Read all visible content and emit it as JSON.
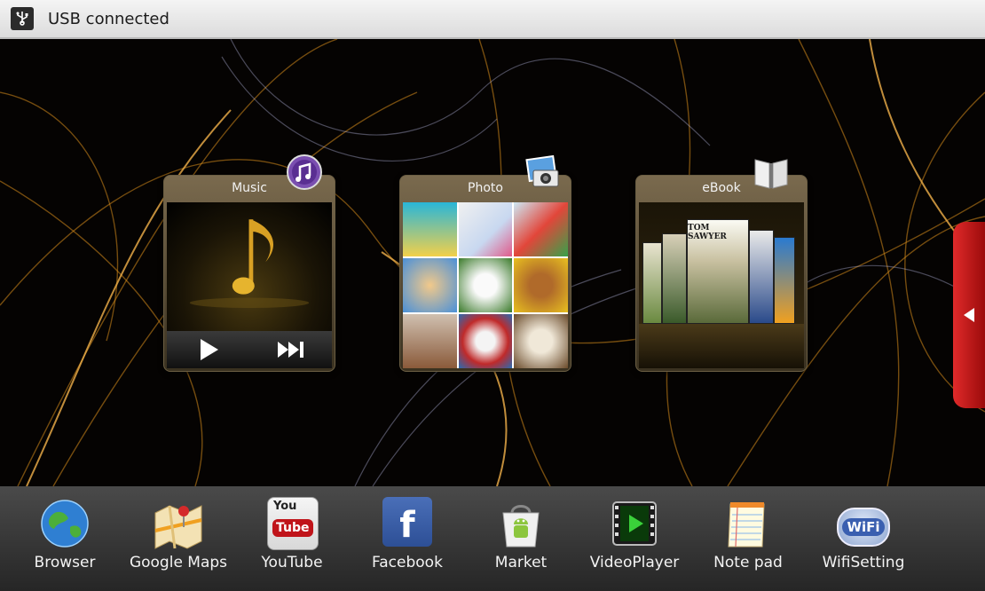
{
  "status_bar": {
    "text": "USB connected",
    "icon": "usb-icon"
  },
  "widgets": [
    {
      "title": "Music",
      "icon": "music-icon"
    },
    {
      "title": "Photo",
      "icon": "photo-icon"
    },
    {
      "title": "eBook",
      "icon": "ebook-icon"
    }
  ],
  "ebook_cover_text": "TOM SAWYER",
  "dock": [
    {
      "label": "Browser",
      "icon": "globe-icon"
    },
    {
      "label": "Google Maps",
      "icon": "map-icon"
    },
    {
      "label": "YouTube",
      "icon": "youtube-icon",
      "badge_top": "You",
      "badge_bottom": "Tube"
    },
    {
      "label": "Facebook",
      "icon": "facebook-icon",
      "glyph": "f"
    },
    {
      "label": "Market",
      "icon": "market-icon"
    },
    {
      "label": "VideoPlayer",
      "icon": "video-player-icon"
    },
    {
      "label": "Note pad",
      "icon": "notepad-icon"
    },
    {
      "label": "WifiSetting",
      "icon": "wifi-icon",
      "glyph": "WiFi"
    }
  ],
  "colors": {
    "accent_red": "#c0141a",
    "wallpaper_gold": "#d48a1c",
    "dock_bg": "#3a3a3a"
  }
}
